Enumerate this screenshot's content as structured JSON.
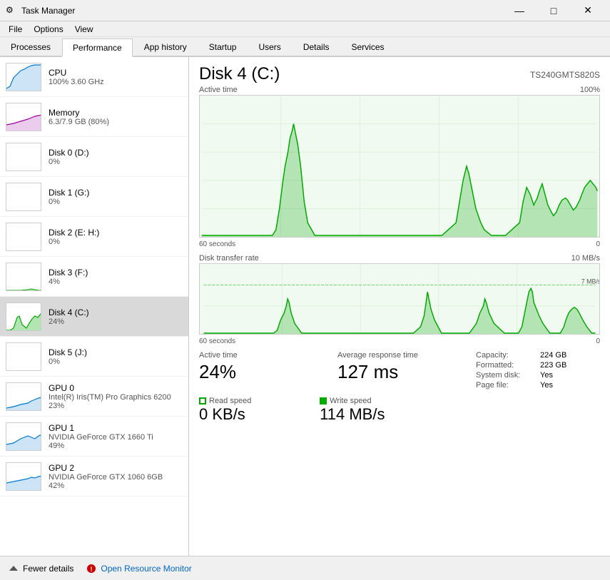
{
  "titleBar": {
    "icon": "⚙",
    "title": "Task Manager",
    "minimizeLabel": "—",
    "maximizeLabel": "□",
    "closeLabel": "✕"
  },
  "menuBar": {
    "items": [
      "File",
      "Options",
      "View"
    ]
  },
  "tabs": {
    "items": [
      "Processes",
      "Performance",
      "App history",
      "Startup",
      "Users",
      "Details",
      "Services"
    ],
    "active": "Performance"
  },
  "sidebar": {
    "items": [
      {
        "id": "cpu",
        "name": "CPU",
        "value": "100% 3.60 GHz",
        "type": "cpu"
      },
      {
        "id": "memory",
        "name": "Memory",
        "value": "6.3/7.9 GB (80%)",
        "type": "memory"
      },
      {
        "id": "disk0",
        "name": "Disk 0 (D:)",
        "value": "0%",
        "type": "disk"
      },
      {
        "id": "disk1",
        "name": "Disk 1 (G:)",
        "value": "0%",
        "type": "disk"
      },
      {
        "id": "disk2",
        "name": "Disk 2 (E: H:)",
        "value": "0%",
        "type": "disk"
      },
      {
        "id": "disk3",
        "name": "Disk 3 (F:)",
        "value": "4%",
        "type": "disk"
      },
      {
        "id": "disk4",
        "name": "Disk 4 (C:)",
        "value": "24%",
        "type": "disk",
        "active": true
      },
      {
        "id": "disk5",
        "name": "Disk 5 (J:)",
        "value": "0%",
        "type": "disk"
      },
      {
        "id": "gpu0",
        "name": "GPU 0",
        "value": "Intel(R) Iris(TM) Pro Graphics 6200\n23%",
        "type": "gpu"
      },
      {
        "id": "gpu1",
        "name": "GPU 1",
        "value": "NVIDIA GeForce GTX 1660 Ti\n49%",
        "type": "gpu"
      },
      {
        "id": "gpu2",
        "name": "GPU 2",
        "value": "NVIDIA GeForce GTX 1060 6GB\n42%",
        "type": "gpu"
      }
    ]
  },
  "content": {
    "title": "Disk 4 (C:)",
    "model": "TS240GMTS820S",
    "activeTimeLabel": "Active time",
    "activeTimeMax": "100%",
    "transferRateLabel": "Disk transfer rate",
    "transferRateMax": "10 MB/s",
    "transferRateRef": "7 MB/s",
    "timeLabel60": "60 seconds",
    "timeLabel0": "0",
    "stats": {
      "activeTimeLabel": "Active time",
      "activeTimeValue": "24%",
      "avgResponseLabel": "Average response time",
      "avgResponseValue": "127 ms",
      "readSpeedLabel": "Read speed",
      "readSpeedValue": "0 KB/s",
      "writeSpeedLabel": "Write speed",
      "writeSpeedValue": "114 MB/s"
    },
    "info": {
      "capacity": {
        "key": "Capacity:",
        "value": "224 GB"
      },
      "formatted": {
        "key": "Formatted:",
        "value": "223 GB"
      },
      "systemDisk": {
        "key": "System disk:",
        "value": "Yes"
      },
      "pageFile": {
        "key": "Page file:",
        "value": "Yes"
      }
    }
  },
  "bottomBar": {
    "fewerDetailsLabel": "Fewer details",
    "openResourceMonitorLabel": "Open Resource Monitor"
  }
}
